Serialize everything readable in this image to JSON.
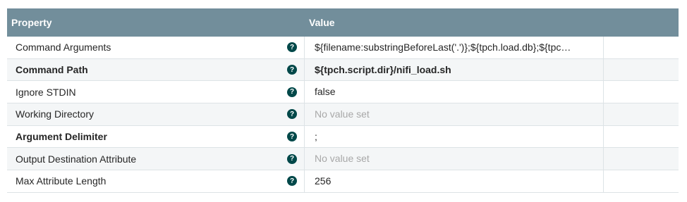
{
  "header": {
    "property": "Property",
    "value": "Value"
  },
  "help_glyph": "?",
  "rows": [
    {
      "property": "Command Arguments",
      "value": "${filename:substringBeforeLast('.')};${tpch.load.db};${tpc…",
      "required": false,
      "unset": false
    },
    {
      "property": "Command Path",
      "value": "${tpch.script.dir}/nifi_load.sh",
      "required": true,
      "unset": false
    },
    {
      "property": "Ignore STDIN",
      "value": "false",
      "required": false,
      "unset": false
    },
    {
      "property": "Working Directory",
      "value": "No value set",
      "required": false,
      "unset": true
    },
    {
      "property": "Argument Delimiter",
      "value": ";",
      "required": true,
      "unset": false
    },
    {
      "property": "Output Destination Attribute",
      "value": "No value set",
      "required": false,
      "unset": true
    },
    {
      "property": "Max Attribute Length",
      "value": "256",
      "required": false,
      "unset": false
    }
  ],
  "colors": {
    "header_bg": "#728e9b",
    "help_icon_bg": "#004849",
    "unset_text": "#a8a8a8"
  }
}
